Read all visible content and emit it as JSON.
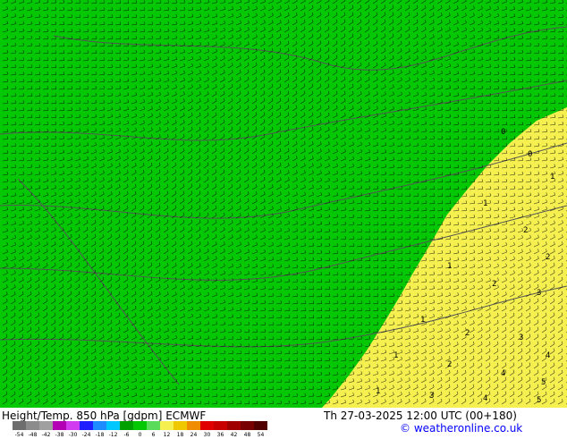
{
  "map": {
    "field_colors": {
      "green": "#05c805",
      "yellow": "#f5f050",
      "barb": "#000000",
      "contour": "#555555"
    },
    "contour_labels": [
      "0",
      "1",
      "2",
      "3",
      "4",
      "5"
    ]
  },
  "footer": {
    "title": "Height/Temp. 850 hPa [gdpm] ECMWF",
    "datetime": "Th 27-03-2025 12:00 UTC (00+180)",
    "credit": "© weatheronline.co.uk"
  },
  "colorbar": {
    "labels": [
      "-54",
      "-48",
      "-42",
      "-38",
      "-30",
      "-24",
      "-18",
      "-12",
      "-6",
      "0",
      "6",
      "12",
      "18",
      "24",
      "30",
      "36",
      "42",
      "48",
      "54"
    ],
    "colors": [
      "#6e6e6e",
      "#8c8c8c",
      "#a0a0a0",
      "#b400b4",
      "#d23cf0",
      "#1e1eff",
      "#1e8cff",
      "#00c8ff",
      "#00a000",
      "#05c805",
      "#5adc5a",
      "#f5f050",
      "#f0c800",
      "#f08c00",
      "#e00000",
      "#c80000",
      "#a00000",
      "#780000",
      "#500000"
    ]
  }
}
